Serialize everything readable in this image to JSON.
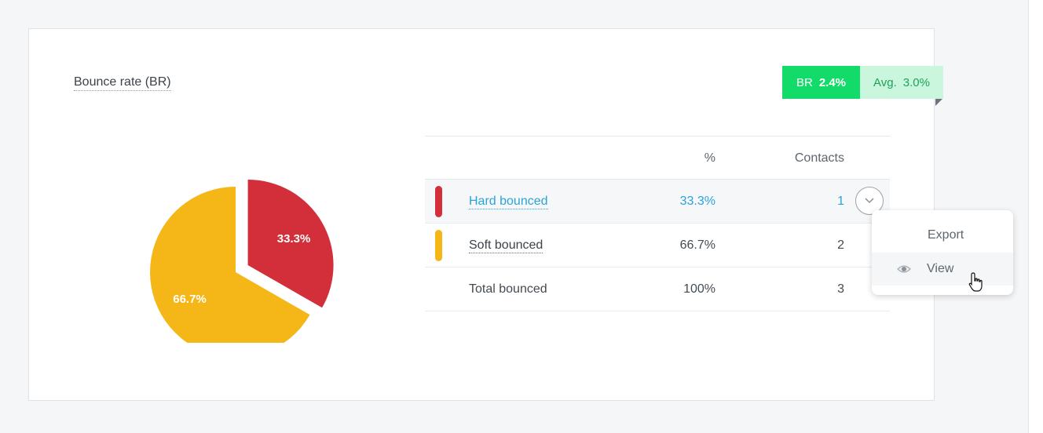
{
  "card": {
    "title": "Bounce rate (BR)",
    "badge": {
      "br_label": "BR",
      "br_value": "2.4%",
      "avg_label": "Avg.",
      "avg_value": "3.0%"
    }
  },
  "chart_data": {
    "type": "pie",
    "slices": [
      {
        "label": "Hard bounced",
        "value": 33.3,
        "display": "33.3%",
        "color": "#d32f3b",
        "exploded": true
      },
      {
        "label": "Soft bounced",
        "value": 66.7,
        "display": "66.7%",
        "color": "#f5b618",
        "exploded": false
      }
    ]
  },
  "table": {
    "headers": {
      "name": "",
      "pct": "%",
      "contacts": "Contacts"
    },
    "rows": [
      {
        "name": "Hard bounced",
        "pct": "33.3%",
        "contacts": "1",
        "color": "#d32f3b"
      },
      {
        "name": "Soft bounced",
        "pct": "66.7%",
        "contacts": "2",
        "color": "#f5b618"
      },
      {
        "name": "Total bounced",
        "pct": "100%",
        "contacts": "3"
      }
    ]
  },
  "menu": {
    "items": [
      {
        "label": "Export"
      },
      {
        "label": "View",
        "icon": "eye-icon"
      }
    ]
  }
}
